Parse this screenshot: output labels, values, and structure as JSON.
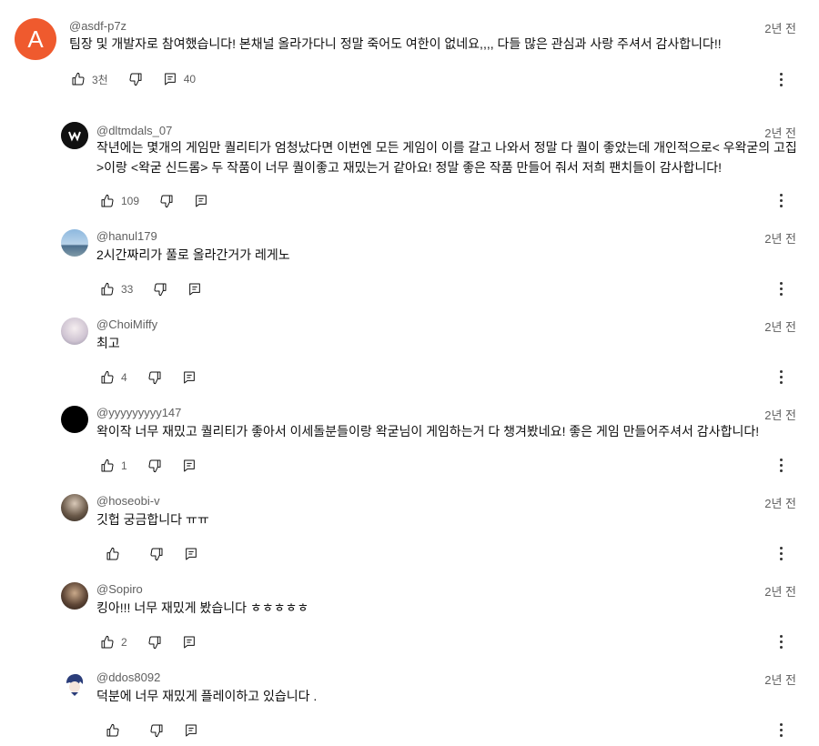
{
  "comments": [
    {
      "author": "@asdf-p7z",
      "time": "2년 전",
      "text": "팀장 및 개발자로 참여했습니다! 본채널 올라가다니 정말 죽어도 여한이 없네요,,,, 다들 많은 관심과 사랑 주셔서 감사합니다!!",
      "likes": "3천",
      "replies": "40",
      "avatar_letter": "A"
    },
    {
      "author": "@dltmdals_07",
      "time": "2년 전",
      "text": "작년에는 몇개의 게임만 퀄리티가 엄청났다면 이번엔 모든 게임이 이를 갈고 나와서 정말 다 퀄이 좋았는데 개인적으로< 우왁굳의 고집 >이랑  <왁굳 신드롬> 두 작품이 너무 퀄이좋고 재밌는거 같아요! 정말 좋은 작품 만들어 줘서 저희 팬치들이 감사합니다!",
      "likes": "109"
    },
    {
      "author": "@hanul179",
      "time": "2년 전",
      "text": "2시간짜리가 풀로 올라간거가 레게노",
      "likes": "33"
    },
    {
      "author": "@ChoiMiffy",
      "time": "2년 전",
      "text": "최고",
      "likes": "4"
    },
    {
      "author": "@yyyyyyyyy147",
      "time": "2년 전",
      "text": "왁이작 너무 재밌고 퀄리티가 좋아서 이세돌분들이랑 왁굳님이 게임하는거 다 챙겨봤네요! 좋은 게임 만들어주셔서 감사합니다!",
      "likes": "1"
    },
    {
      "author": "@hoseobi-v",
      "time": "2년 전",
      "text": "깃헙 궁금합니다 ㅠㅠ",
      "likes": ""
    },
    {
      "author": "@Sopiro",
      "time": "2년 전",
      "text": "킹아!!! 너무 재밌게 봤습니다 ㅎㅎㅎㅎㅎ",
      "likes": "2"
    },
    {
      "author": "@ddos8092",
      "time": "2년 전",
      "text": "덕분에 너무 재밌게 플레이하고 있습니다 .",
      "likes": ""
    }
  ],
  "icons": {
    "like": "thumbs-up-icon",
    "dislike": "thumbs-down-icon",
    "reply": "reply-icon",
    "more": "more-vert-icon"
  },
  "colors": {
    "avatar_top": "#ef5a2e",
    "meta_text": "#606060",
    "body_text": "#0f0f0f"
  }
}
